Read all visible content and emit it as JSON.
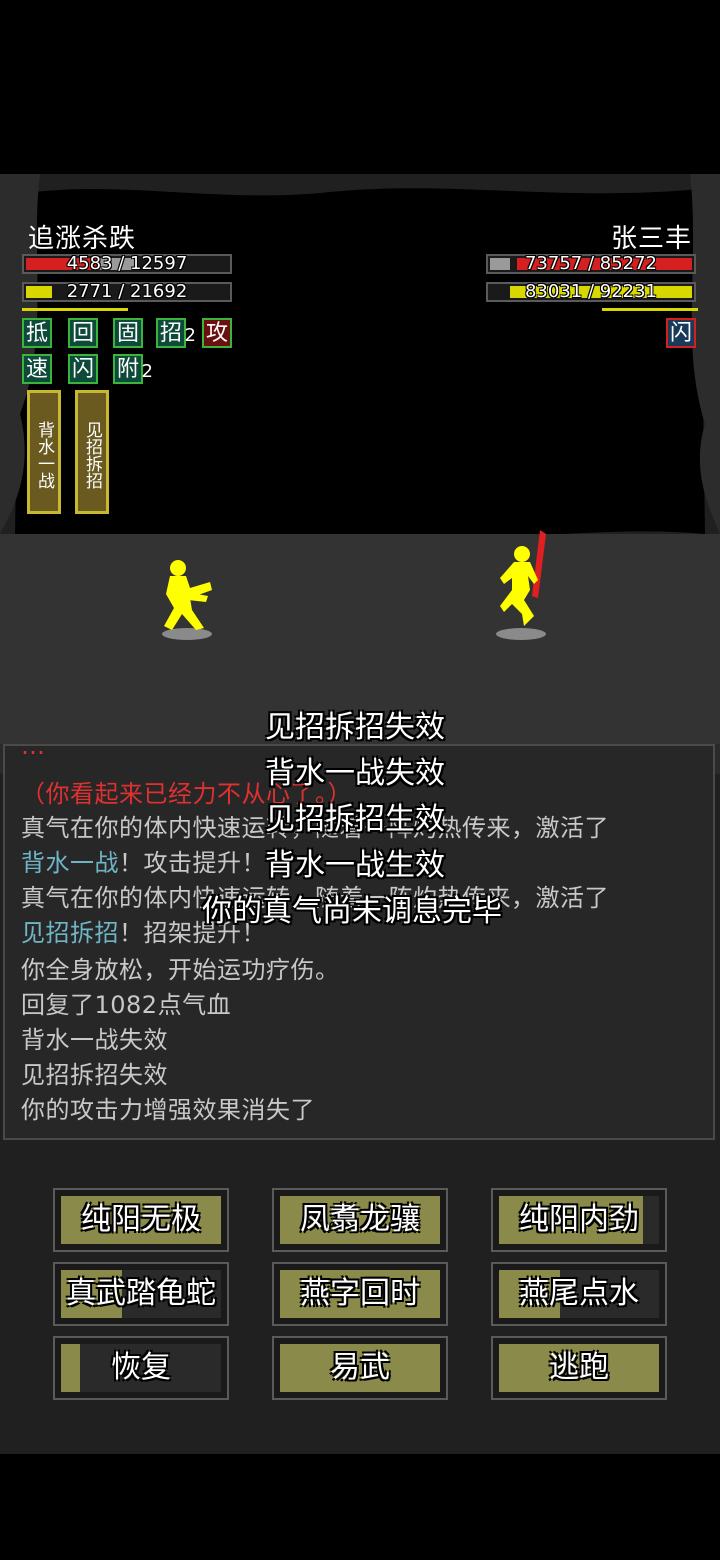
{
  "player": {
    "name": "追涨杀跌",
    "hp_text": "4583 / 12597",
    "hp_fraction": 0.364,
    "mp_text": "2771 / 21692",
    "mp_fraction": 0.128,
    "buffs": [
      {
        "label": "抵",
        "sub": ""
      },
      {
        "label": "回",
        "sub": ""
      },
      {
        "label": "固",
        "sub": ""
      },
      {
        "label": "招",
        "sub": "2"
      },
      {
        "label": "攻",
        "sub": ""
      },
      {
        "label": "速",
        "sub": ""
      },
      {
        "label": "闪",
        "sub": ""
      },
      {
        "label": "附",
        "sub": "2"
      }
    ],
    "skills": [
      "背水一战",
      "见招拆招"
    ]
  },
  "enemy": {
    "name": "张三丰",
    "hp_text": "73757 / 85272",
    "hp_fraction": 0.865,
    "mp_text": "83031 / 92231",
    "mp_fraction": 0.9,
    "buffs": [
      {
        "label": "闪",
        "sub": ""
      }
    ]
  },
  "floating_texts": [
    "见招拆招失效",
    "背水一战失效",
    "见招拆招生效",
    "背水一战生效",
    "你的真气尚未调息完毕"
  ],
  "log": {
    "line0": "（你看起来已经力不从心了。）",
    "line1": "真气在你的体内快速运转，随着一阵灼热传来，激活了",
    "line2a": "背水一战",
    "line2b": "！攻击提升！",
    "line3": "真气在你的体内快速运转，随着一阵灼热传来，激活了",
    "line4a": "见招拆招",
    "line4b": "！招架提升！",
    "line5": "你全身放松，开始运功疗伤。",
    "line6": "回复了1082点气血",
    "line7": "背水一战失效",
    "line8": "见招拆招失效",
    "line9": "你的攻击力增强效果消失了"
  },
  "actions": [
    "纯阳无极",
    "凤翥龙骧",
    "纯阳内劲",
    "真武踏龟蛇",
    "燕字回时",
    "燕尾点水",
    "恢复",
    "易武",
    "逃跑"
  ]
}
